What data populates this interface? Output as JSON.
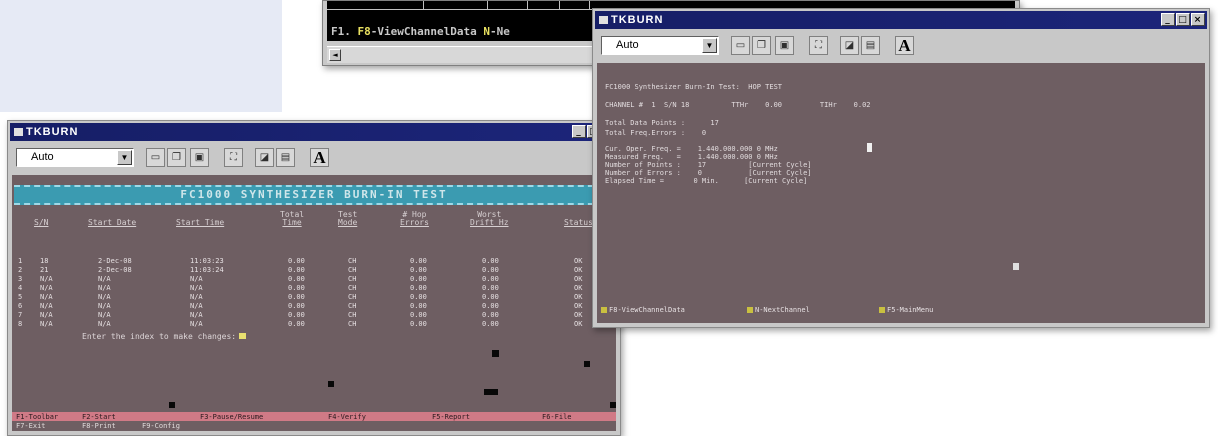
{
  "terminal_window": {
    "fkeys_prefix": "F1.",
    "fkeys_f8": "F8",
    "fkeys_f8_label": "-ViewChannelData",
    "fkeys_n": "N",
    "fkeys_n_label": "-Ne",
    "scroll_left_glyph": "◄"
  },
  "window_controls": {
    "minimize": "_",
    "maximize": "□",
    "close": "×"
  },
  "left_window": {
    "title": "TKBURN",
    "zoom_value": "Auto",
    "banner": "FC1000   SYNTHESIZER  BURN-IN  TEST",
    "headers": [
      {
        "l1": "",
        "l2": "S/N"
      },
      {
        "l1": "",
        "l2": "Start Date"
      },
      {
        "l1": "",
        "l2": "Start Time"
      },
      {
        "l1": "Total",
        "l2": "Time"
      },
      {
        "l1": "Test",
        "l2": "Mode"
      },
      {
        "l1": "# Hop",
        "l2": "Errors"
      },
      {
        "l1": "Worst",
        "l2": "Drift Hz"
      },
      {
        "l1": "",
        "l2": "Status"
      }
    ],
    "rows": [
      {
        "n": "1",
        "sn": "18",
        "date": "2-Dec-08",
        "time": "11:03:23",
        "total": "0.00",
        "mode": "CH",
        "errors": "0.00",
        "drift": "0.00",
        "status": "OK"
      },
      {
        "n": "2",
        "sn": "21",
        "date": "2-Dec-08",
        "time": "11:03:24",
        "total": "0.00",
        "mode": "CH",
        "errors": "0.00",
        "drift": "0.00",
        "status": "OK"
      },
      {
        "n": "3",
        "sn": "N/A",
        "date": "N/A",
        "time": "N/A",
        "total": "0.00",
        "mode": "CH",
        "errors": "0.00",
        "drift": "0.00",
        "status": "OK"
      },
      {
        "n": "4",
        "sn": "N/A",
        "date": "N/A",
        "time": "N/A",
        "total": "0.00",
        "mode": "CH",
        "errors": "0.00",
        "drift": "0.00",
        "status": "OK"
      },
      {
        "n": "5",
        "sn": "N/A",
        "date": "N/A",
        "time": "N/A",
        "total": "0.00",
        "mode": "CH",
        "errors": "0.00",
        "drift": "0.00",
        "status": "OK"
      },
      {
        "n": "6",
        "sn": "N/A",
        "date": "N/A",
        "time": "N/A",
        "total": "0.00",
        "mode": "CH",
        "errors": "0.00",
        "drift": "0.00",
        "status": "OK"
      },
      {
        "n": "7",
        "sn": "N/A",
        "date": "N/A",
        "time": "N/A",
        "total": "0.00",
        "mode": "CH",
        "errors": "0.00",
        "drift": "0.00",
        "status": "OK"
      },
      {
        "n": "8",
        "sn": "N/A",
        "date": "N/A",
        "time": "N/A",
        "total": "0.00",
        "mode": "CH",
        "errors": "0.00",
        "drift": "0.00",
        "status": "OK"
      }
    ],
    "prompt": "Enter the index to make changes:",
    "fkeys1": [
      "F1-Toolbar",
      "F2-Start",
      "F3-Pause/Resume",
      "F4-Verify",
      "F5-Report",
      "F6-File"
    ],
    "fkeys2": [
      "F7-Exit",
      "F8-Print",
      "F9-Config"
    ]
  },
  "right_window": {
    "title": "TKBURN",
    "zoom_value": "Auto",
    "line1": "FC1000 Synthesizer Burn-In Test:  HOP TEST",
    "line2": "CHANNEL #  1  S/N 18          TTHr    0.00         TIHr    0.02",
    "line3": "Total Data Points :      17",
    "line4": "Total Freq.Errors :    0",
    "line5": "Cur. Oper. Freq. =    1.440.000.000 0 MHz",
    "line6": "Measured Freq.   =    1.440.000.000 0 MHz",
    "line7": "Number of Points :    17          [Current Cycle]",
    "line8": "Number of Errors :    0           [Current Cycle]",
    "line9": "Elapsed Time =       0 Min.      [Current Cycle]",
    "bottom_f8": "F8",
    "bottom_f8_label": "-ViewChannelData",
    "bottom_n": "N",
    "bottom_n_label": "-NextChannel",
    "bottom_f5": "F5",
    "bottom_f5_label": "-MainMenu"
  }
}
